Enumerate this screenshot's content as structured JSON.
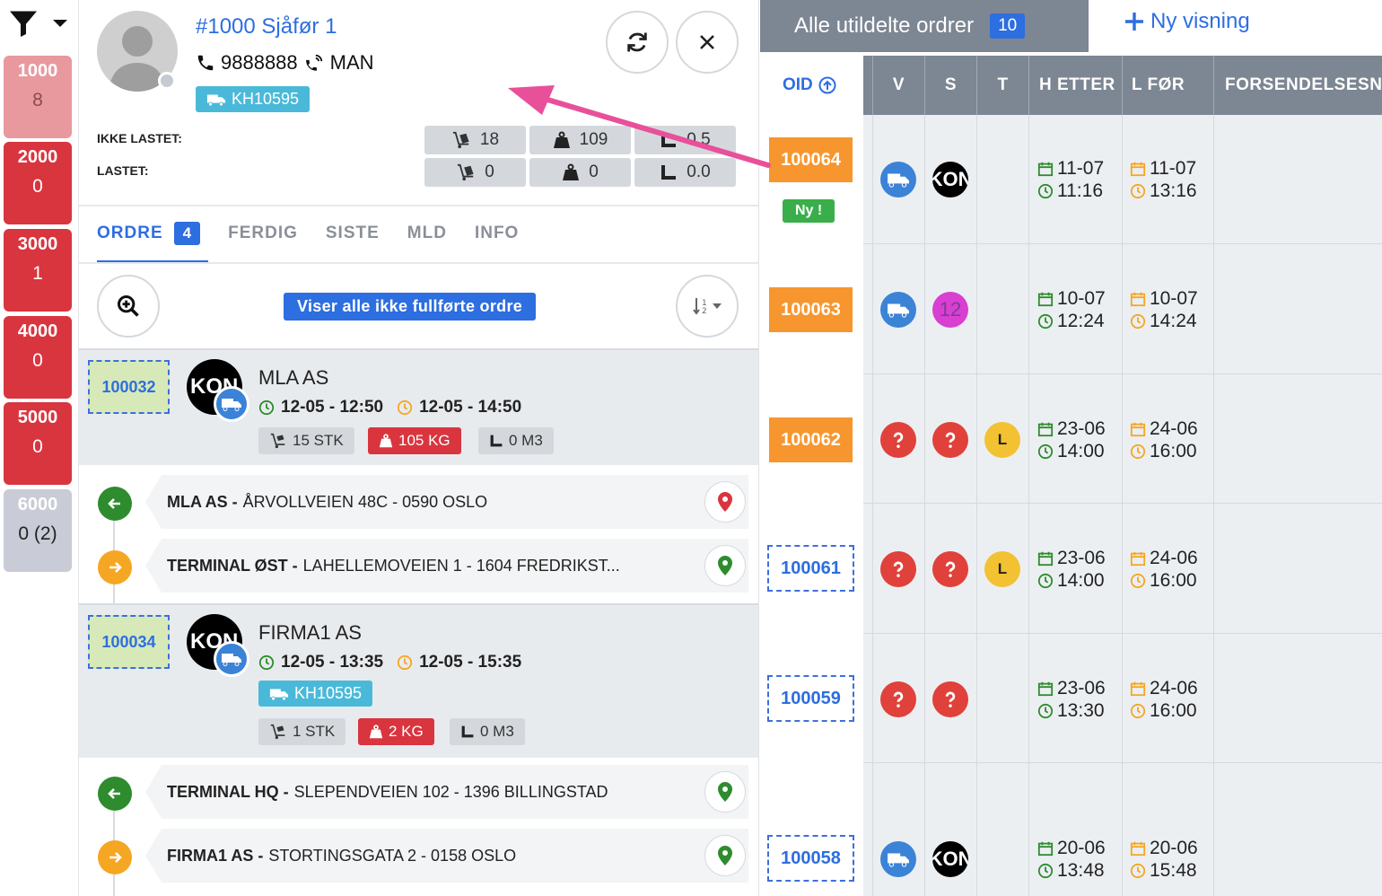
{
  "rail": {
    "boxes": [
      {
        "num": "1000",
        "count": "8"
      },
      {
        "num": "2000",
        "count": "0"
      },
      {
        "num": "3000",
        "count": "1"
      },
      {
        "num": "4000",
        "count": "0"
      },
      {
        "num": "5000",
        "count": "0"
      },
      {
        "num": "6000",
        "count": "0 (2)"
      }
    ]
  },
  "driver": {
    "title": "#1000 Sjåfør 1",
    "phone": "9888888",
    "mode": "MAN",
    "vehicle": "KH10595"
  },
  "load": {
    "not_loaded_label": "IKKE LASTET:",
    "loaded_label": "LASTET:",
    "not_loaded": {
      "pallets": "18",
      "weight": "109",
      "volume": "0.5"
    },
    "loaded": {
      "pallets": "0",
      "weight": "0",
      "volume": "0.0"
    }
  },
  "tabs": {
    "ordre": "ORDRE",
    "ordre_count": "4",
    "ferdig": "FERDIG",
    "siste": "SISTE",
    "mld": "MLD",
    "info": "INFO"
  },
  "banner": "Viser alle ikke fullførte ordre",
  "orders": [
    {
      "oid": "100032",
      "logo": "KON",
      "customer": "MLA AS",
      "pickup": "12-05 - 12:50",
      "delivery": "12-05 - 14:50",
      "qty": "15 STK",
      "weight": "105 KG",
      "volume": "0 M3",
      "from_name": "MLA AS -",
      "from_addr": "ÅRVOLLVEIEN 48C - 0590 OSLO",
      "to_name": "TERMINAL ØST -",
      "to_addr": "LAHELLEMOVEIEN 1 - 1604 FREDRIKST..."
    },
    {
      "oid": "100034",
      "logo": "KON",
      "customer": "FIRMA1 AS",
      "pickup": "12-05 - 13:35",
      "delivery": "12-05 - 15:35",
      "vehicle": "KH10595",
      "qty": "1 STK",
      "weight": "2 KG",
      "volume": "0 M3",
      "from_name": "TERMINAL HQ -",
      "from_addr": "SLEPENDVEIEN 102 - 1396 BILLINGSTAD",
      "to_name": "FIRMA1 AS -",
      "to_addr": "STORTINGSGATA 2 - 0158 OSLO"
    }
  ],
  "right": {
    "view_title": "Alle utildelte ordrer",
    "view_count": "10",
    "new_view": "Ny visning",
    "oid_header": "OID",
    "new_badge": "Ny !",
    "headers": [
      "V",
      "S",
      "T",
      "H ETTER",
      "L FØR",
      "FORSENDELSESNR"
    ],
    "rows": [
      {
        "oid": "100064",
        "style": "orange",
        "v": "truck",
        "s": "KON",
        "t": "",
        "h_date": "11-07",
        "h_time": "11:16",
        "l_date": "11-07",
        "l_time": "13:16"
      },
      {
        "oid": "100063",
        "style": "orange",
        "v": "truck",
        "s": "12",
        "t": "",
        "h_date": "10-07",
        "h_time": "12:24",
        "l_date": "10-07",
        "l_time": "14:24"
      },
      {
        "oid": "100062",
        "style": "orange",
        "v": "question",
        "s": "question",
        "t": "L",
        "h_date": "23-06",
        "h_time": "14:00",
        "l_date": "24-06",
        "l_time": "16:00"
      },
      {
        "oid": "100061",
        "style": "dashed",
        "v": "question",
        "s": "question",
        "t": "L",
        "h_date": "23-06",
        "h_time": "14:00",
        "l_date": "24-06",
        "l_time": "16:00"
      },
      {
        "oid": "100059",
        "style": "dashed",
        "v": "question",
        "s": "question",
        "t": "",
        "h_date": "23-06",
        "h_time": "13:30",
        "l_date": "24-06",
        "l_time": "16:00"
      },
      {
        "oid": "100058",
        "style": "dashed",
        "v": "truck",
        "s": "KON",
        "t": "",
        "h_date": "20-06",
        "h_time": "13:48",
        "l_date": "20-06",
        "l_time": "15:48"
      }
    ]
  },
  "colors": {
    "primary": "#2d6ee0",
    "danger": "#d9353f",
    "orange": "#f7962e",
    "annotation_arrow": "#e8509a"
  }
}
